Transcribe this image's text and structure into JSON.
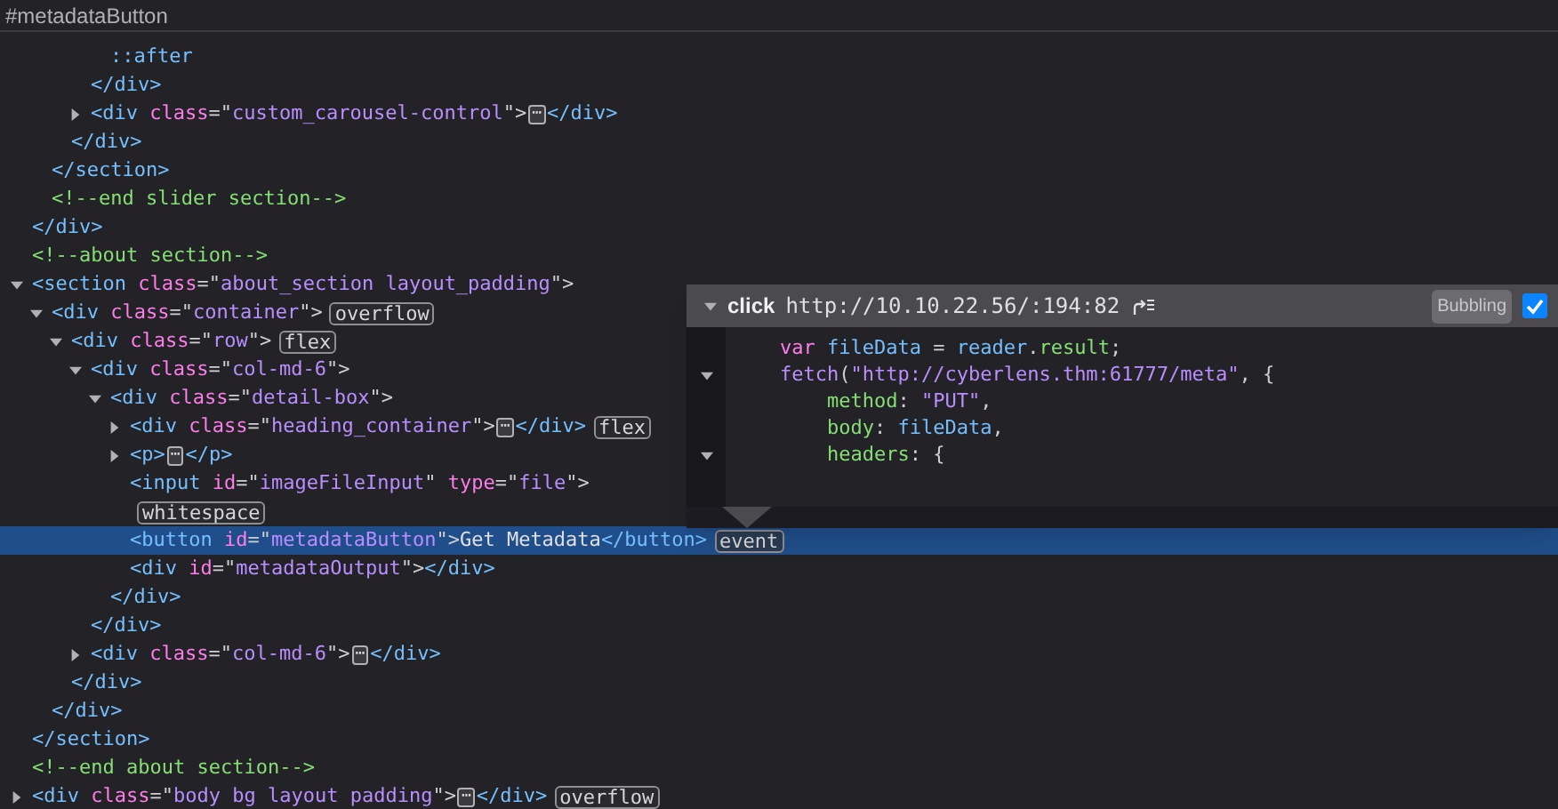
{
  "breadcrumb": "#metadataButton",
  "tree": [
    {
      "kind": "hidden",
      "children": [
        {
          "kind": "hidden",
          "children": [
            {
              "kind": "hidden",
              "children": [
                {
                  "kind": "hidden",
                  "children": [
                    {
                      "kind": "leaf",
                      "selected": false,
                      "tokens": [
                        {
                          "kind": "tag",
                          "t": "::after"
                        }
                      ]
                    }
                  ],
                  "closing": "</div>"
                },
                {
                  "kind": "element",
                  "expanded": false,
                  "selected": false,
                  "tokens": [
                    {
                      "kind": "tag",
                      "t": "<div"
                    },
                    {
                      "kind": "attr",
                      "t": " class"
                    },
                    {
                      "kind": "p",
                      "t": "=\""
                    },
                    {
                      "kind": "val",
                      "t": "custom_carousel-control"
                    },
                    {
                      "kind": "p",
                      "t": "\">"
                    },
                    {
                      "kind": "ellipsis",
                      "t": "⋯"
                    },
                    {
                      "kind": "tag",
                      "t": "</div>"
                    }
                  ]
                }
              ],
              "closing": "</div>"
            }
          ],
          "closing": "</section>"
        },
        {
          "kind": "leaf",
          "selected": false,
          "tokens": [
            {
              "kind": "comment",
              "t": "<!--end slider section-->"
            }
          ]
        }
      ],
      "closing": "</div>"
    },
    {
      "kind": "leaf",
      "selected": false,
      "tokens": [
        {
          "kind": "comment",
          "t": "<!--about section-->"
        }
      ]
    },
    {
      "kind": "element",
      "expanded": true,
      "selected": false,
      "tokens": [
        {
          "kind": "tag",
          "t": "<section"
        },
        {
          "kind": "attr",
          "t": " class"
        },
        {
          "kind": "p",
          "t": "=\""
        },
        {
          "kind": "val",
          "t": "about_section layout_padding"
        },
        {
          "kind": "p",
          "t": "\">"
        }
      ],
      "closing": "</section>",
      "children": [
        {
          "kind": "element",
          "expanded": true,
          "selected": false,
          "tokens": [
            {
              "kind": "tag",
              "t": "<div"
            },
            {
              "kind": "attr",
              "t": " class"
            },
            {
              "kind": "p",
              "t": "=\""
            },
            {
              "kind": "val",
              "t": "container"
            },
            {
              "kind": "p",
              "t": "\">"
            },
            {
              "kind": "badge",
              "t": "overflow"
            }
          ],
          "closing": "</div>",
          "children": [
            {
              "kind": "element",
              "expanded": true,
              "selected": false,
              "tokens": [
                {
                  "kind": "tag",
                  "t": "<div"
                },
                {
                  "kind": "attr",
                  "t": " class"
                },
                {
                  "kind": "p",
                  "t": "=\""
                },
                {
                  "kind": "val",
                  "t": "row"
                },
                {
                  "kind": "p",
                  "t": "\">"
                },
                {
                  "kind": "badge",
                  "t": "flex"
                }
              ],
              "closing": "</div>",
              "children": [
                {
                  "kind": "element",
                  "expanded": true,
                  "selected": false,
                  "tokens": [
                    {
                      "kind": "tag",
                      "t": "<div"
                    },
                    {
                      "kind": "attr",
                      "t": " class"
                    },
                    {
                      "kind": "p",
                      "t": "=\""
                    },
                    {
                      "kind": "val",
                      "t": "col-md-6"
                    },
                    {
                      "kind": "p",
                      "t": "\">"
                    }
                  ],
                  "closing": "</div>",
                  "children": [
                    {
                      "kind": "element",
                      "expanded": true,
                      "selected": false,
                      "tokens": [
                        {
                          "kind": "tag",
                          "t": "<div"
                        },
                        {
                          "kind": "attr",
                          "t": " class"
                        },
                        {
                          "kind": "p",
                          "t": "=\""
                        },
                        {
                          "kind": "val",
                          "t": "detail-box"
                        },
                        {
                          "kind": "p",
                          "t": "\">"
                        }
                      ],
                      "closing": "</div>",
                      "children": [
                        {
                          "kind": "element",
                          "expanded": false,
                          "selected": false,
                          "tokens": [
                            {
                              "kind": "tag",
                              "t": "<div"
                            },
                            {
                              "kind": "attr",
                              "t": " class"
                            },
                            {
                              "kind": "p",
                              "t": "=\""
                            },
                            {
                              "kind": "val",
                              "t": "heading_container"
                            },
                            {
                              "kind": "p",
                              "t": "\">"
                            },
                            {
                              "kind": "ellipsis",
                              "t": "⋯"
                            },
                            {
                              "kind": "tag",
                              "t": "</div>"
                            },
                            {
                              "kind": "badge",
                              "t": "flex"
                            }
                          ]
                        },
                        {
                          "kind": "element",
                          "expanded": false,
                          "selected": false,
                          "tokens": [
                            {
                              "kind": "tag",
                              "t": "<p>"
                            },
                            {
                              "kind": "ellipsis",
                              "t": "⋯"
                            },
                            {
                              "kind": "tag",
                              "t": "</p>"
                            }
                          ]
                        },
                        {
                          "kind": "leaf",
                          "selected": false,
                          "tokens": [
                            {
                              "kind": "tag",
                              "t": "<input"
                            },
                            {
                              "kind": "attr",
                              "t": " id"
                            },
                            {
                              "kind": "p",
                              "t": "=\""
                            },
                            {
                              "kind": "val",
                              "t": "imageFileInput"
                            },
                            {
                              "kind": "p",
                              "t": "\""
                            },
                            {
                              "kind": "attr",
                              "t": " type"
                            },
                            {
                              "kind": "p",
                              "t": "=\""
                            },
                            {
                              "kind": "val",
                              "t": "file"
                            },
                            {
                              "kind": "p",
                              "t": "\">"
                            }
                          ]
                        },
                        {
                          "kind": "leaf",
                          "selected": false,
                          "tokens": [
                            {
                              "kind": "badge",
                              "t": "whitespace"
                            }
                          ]
                        },
                        {
                          "kind": "leaf",
                          "selected": true,
                          "tokens": [
                            {
                              "kind": "tag",
                              "t": "<button"
                            },
                            {
                              "kind": "attr",
                              "t": " id"
                            },
                            {
                              "kind": "p",
                              "t": "=\""
                            },
                            {
                              "kind": "val",
                              "t": "metadataButton"
                            },
                            {
                              "kind": "p",
                              "t": "\">"
                            },
                            {
                              "kind": "text",
                              "t": "Get Metadata"
                            },
                            {
                              "kind": "tag",
                              "t": "</button>"
                            },
                            {
                              "kind": "badge",
                              "t": "event"
                            }
                          ]
                        },
                        {
                          "kind": "leaf",
                          "selected": false,
                          "tokens": [
                            {
                              "kind": "tag",
                              "t": "<div"
                            },
                            {
                              "kind": "attr",
                              "t": " id"
                            },
                            {
                              "kind": "p",
                              "t": "=\""
                            },
                            {
                              "kind": "val",
                              "t": "metadataOutput"
                            },
                            {
                              "kind": "p",
                              "t": "\">"
                            },
                            {
                              "kind": "tag",
                              "t": "</div>"
                            }
                          ]
                        }
                      ]
                    }
                  ]
                },
                {
                  "kind": "element",
                  "expanded": false,
                  "selected": false,
                  "tokens": [
                    {
                      "kind": "tag",
                      "t": "<div"
                    },
                    {
                      "kind": "attr",
                      "t": " class"
                    },
                    {
                      "kind": "p",
                      "t": "=\""
                    },
                    {
                      "kind": "val",
                      "t": "col-md-6"
                    },
                    {
                      "kind": "p",
                      "t": "\">"
                    },
                    {
                      "kind": "ellipsis",
                      "t": "⋯"
                    },
                    {
                      "kind": "tag",
                      "t": "</div>"
                    }
                  ]
                }
              ]
            }
          ]
        }
      ]
    },
    {
      "kind": "leaf",
      "selected": false,
      "tokens": [
        {
          "kind": "comment",
          "t": "<!--end about section-->"
        }
      ]
    },
    {
      "kind": "element",
      "expanded": false,
      "selected": false,
      "tokens": [
        {
          "kind": "tag",
          "t": "<div"
        },
        {
          "kind": "attr",
          "t": " class"
        },
        {
          "kind": "p",
          "t": "=\""
        },
        {
          "kind": "val",
          "t": "body bg layout padding"
        },
        {
          "kind": "p",
          "t": "\">"
        },
        {
          "kind": "ellipsis",
          "t": "⋯"
        },
        {
          "kind": "tag",
          "t": "</div>"
        },
        {
          "kind": "badge",
          "t": "overflow"
        }
      ]
    }
  ],
  "event_popup": {
    "expanded": true,
    "event": "click",
    "source": "http://10.10.22.56/:194:82",
    "phase": "Bubbling",
    "enabled": true,
    "code": [
      {
        "fold": false,
        "tokens": [
          {
            "kind": "kw",
            "t": "    var"
          },
          {
            "kind": "id",
            "t": " fileData"
          },
          {
            "kind": "p",
            "t": " = "
          },
          {
            "kind": "id",
            "t": "reader"
          },
          {
            "kind": "p",
            "t": "."
          },
          {
            "kind": "prop",
            "t": "result"
          },
          {
            "kind": "p",
            "t": ";"
          }
        ]
      },
      {
        "fold": true,
        "tokens": [
          {
            "kind": "fn",
            "t": "    fetch"
          },
          {
            "kind": "p",
            "t": "("
          },
          {
            "kind": "str",
            "t": "\"http://cyberlens.thm:61777/meta\""
          },
          {
            "kind": "p",
            "t": ", {"
          }
        ]
      },
      {
        "fold": false,
        "tokens": [
          {
            "kind": "prop",
            "t": "        method"
          },
          {
            "kind": "p",
            "t": ": "
          },
          {
            "kind": "str",
            "t": "\"PUT\""
          },
          {
            "kind": "p",
            "t": ","
          }
        ]
      },
      {
        "fold": false,
        "tokens": [
          {
            "kind": "prop",
            "t": "        body"
          },
          {
            "kind": "p",
            "t": ": "
          },
          {
            "kind": "id",
            "t": "fileData"
          },
          {
            "kind": "p",
            "t": ","
          }
        ]
      },
      {
        "fold": true,
        "tokens": [
          {
            "kind": "prop",
            "t": "        headers"
          },
          {
            "kind": "p",
            "t": ": {"
          }
        ]
      }
    ]
  }
}
